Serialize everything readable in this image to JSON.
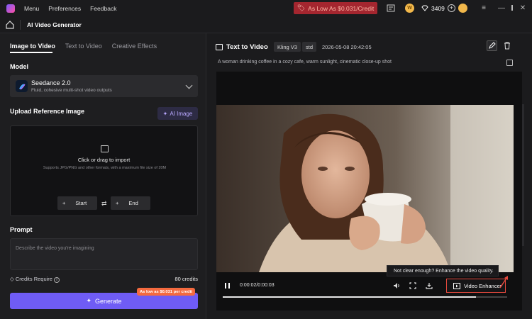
{
  "titlebar": {
    "menu": [
      "Menu",
      "Preferences",
      "Feedback"
    ],
    "promo": "As Low As $0.031/Credit",
    "credits": "3409",
    "colors": {
      "promo_bg": "#a4262f",
      "accent": "#6f5cf5"
    }
  },
  "subbar": {
    "title": "AI Video Generator"
  },
  "left": {
    "tabs": [
      {
        "label": "Image to Video",
        "active": true
      },
      {
        "label": "Text to Video",
        "active": false
      },
      {
        "label": "Creative Effects",
        "active": false
      }
    ],
    "model_label": "Model",
    "model": {
      "name": "Seedance 2.0",
      "desc": "Fluid, cohesive multi-shot video outputs"
    },
    "upload_label": "Upload Reference Image",
    "ai_image": "AI Image",
    "upload": {
      "title": "Click or drag to import",
      "hint": "Supports JPG/PNG and other formats, with a maximum file size of 20M",
      "start": "Start",
      "end": "End"
    },
    "prompt_label": "Prompt",
    "prompt_placeholder": "Describe the video you're imagining",
    "credits_label": "Credits Require",
    "credits_value": "80 credits",
    "generate": "Generate",
    "badge": "As low as $0.031 per credit"
  },
  "right": {
    "title": "Text to Video",
    "model_tag": "Kling V3",
    "mode_tag": "std",
    "date": "2026-05-08 20:42:05",
    "prompt": "A woman drinking coffee in a cozy cafe, warm sunlight, cinematic close-up shot",
    "player": {
      "time": "0:00:02/0:00:03",
      "progress": 0.89,
      "tooltip": "Not clear enough? Enhance the video quality.",
      "enhancer": "Video Enhancer"
    }
  }
}
